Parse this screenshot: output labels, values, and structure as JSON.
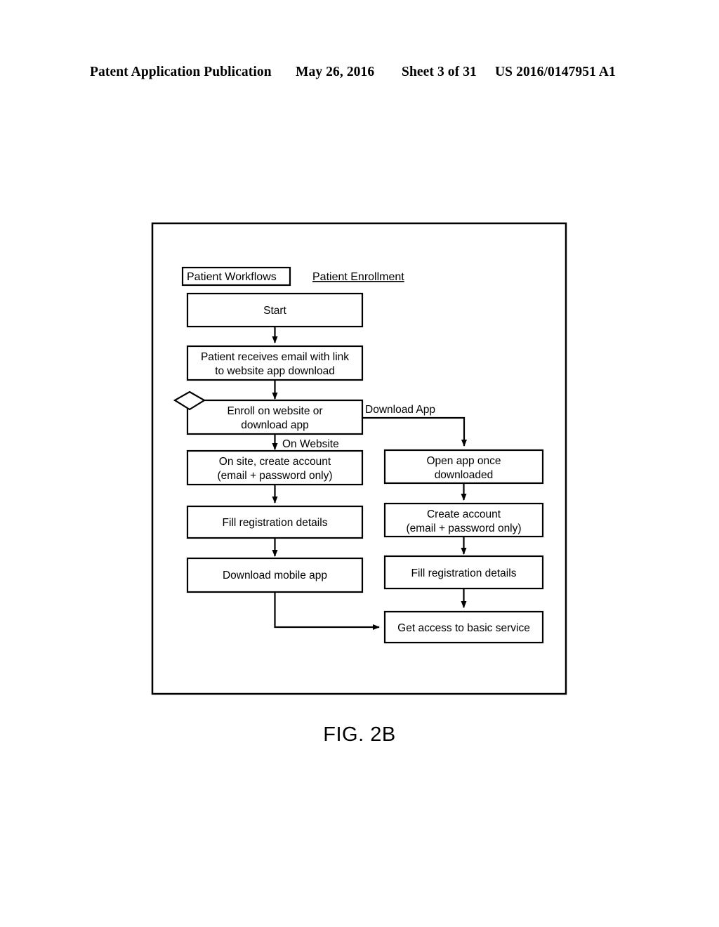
{
  "header": {
    "publication": "Patent Application Publication",
    "date": "May 26, 2016",
    "sheet": "Sheet 3 of 31",
    "document_number": "US 2016/0147951 A1"
  },
  "figure": {
    "caption": "FIG. 2B",
    "swimlane_label": "Patient Workflows",
    "diagram_title": "Patient Enrollment"
  },
  "flowchart": {
    "type": "flowchart",
    "nodes": {
      "start": {
        "label": "Start",
        "shape": "rectangle"
      },
      "receive_email": {
        "line1": "Patient receives email with link",
        "line2": "to website app download",
        "shape": "rectangle"
      },
      "decision": {
        "line1": "Enroll on website or",
        "line2": "download app",
        "shape": "decision"
      },
      "site_create_account": {
        "line1": "On site, create account",
        "line2": "(email + password only)",
        "shape": "rectangle"
      },
      "fill_registration_left": {
        "label": "Fill registration details",
        "shape": "rectangle"
      },
      "download_mobile_app": {
        "label": "Download mobile app",
        "shape": "rectangle"
      },
      "open_app": {
        "line1": "Open app once",
        "line2": "downloaded",
        "shape": "rectangle"
      },
      "create_account_right": {
        "line1": "Create account",
        "line2": "(email + password only)",
        "shape": "rectangle"
      },
      "fill_registration_right": {
        "label": "Fill registration details",
        "shape": "rectangle"
      },
      "get_access": {
        "label": "Get access to basic service",
        "shape": "rectangle"
      }
    },
    "edge_labels": {
      "download_app": "Download App",
      "on_website": "On Website"
    },
    "edges": [
      {
        "from": "start",
        "to": "receive_email",
        "label": ""
      },
      {
        "from": "receive_email",
        "to": "decision",
        "label": ""
      },
      {
        "from": "decision",
        "to": "site_create_account",
        "label": "On Website"
      },
      {
        "from": "decision",
        "to": "open_app",
        "label": "Download App"
      },
      {
        "from": "site_create_account",
        "to": "fill_registration_left",
        "label": ""
      },
      {
        "from": "fill_registration_left",
        "to": "download_mobile_app",
        "label": ""
      },
      {
        "from": "download_mobile_app",
        "to": "get_access",
        "label": ""
      },
      {
        "from": "open_app",
        "to": "create_account_right",
        "label": ""
      },
      {
        "from": "create_account_right",
        "to": "fill_registration_right",
        "label": ""
      },
      {
        "from": "fill_registration_right",
        "to": "get_access",
        "label": ""
      }
    ]
  }
}
